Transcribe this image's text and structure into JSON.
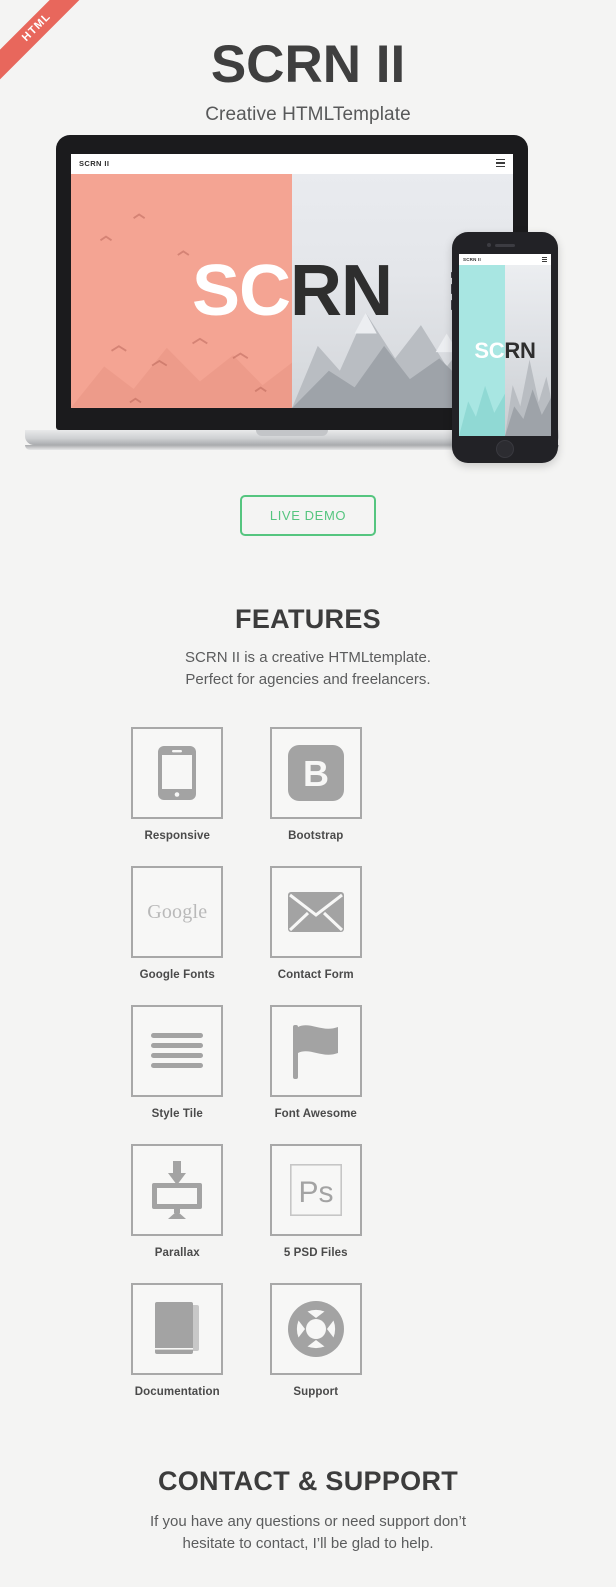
{
  "ribbon": {
    "label": "HTML",
    "color": "#e8675c"
  },
  "hero": {
    "title": "SCRN II",
    "subtitle": "Creative HTMLTemplate"
  },
  "mockup": {
    "laptop": {
      "site_logo": "SCRN II",
      "menu_icon": "hamburger-icon",
      "headline_left": "SC",
      "headline_right": "RN",
      "left_panel_color": "#f4a493",
      "right_panel_color": "#e4e6ea"
    },
    "phone": {
      "site_logo": "SCRN II",
      "menu_icon": "hamburger-icon",
      "headline_left": "SC",
      "headline_right": "RN",
      "left_panel_color": "#a8e6e2",
      "right_panel_color": "#dcdfe3"
    }
  },
  "demo": {
    "label": "LIVE DEMO",
    "color": "#55c57f"
  },
  "features": {
    "title": "FEATURES",
    "description_line1": "SCRN II is a creative HTMLtemplate.",
    "description_line2": "Perfect for agencies and freelancers.",
    "items": [
      {
        "label": "Responsive",
        "icon": "smartphone-icon"
      },
      {
        "label": "Bootstrap",
        "icon": "bootstrap-b-icon"
      },
      {
        "label": "Google Fonts",
        "icon": "google-wordmark-icon",
        "text": "Google"
      },
      {
        "label": "Contact Form",
        "icon": "envelope-icon"
      },
      {
        "label": "Style Tile",
        "icon": "lines-icon"
      },
      {
        "label": "Font Awesome",
        "icon": "flag-icon"
      },
      {
        "label": "Parallax",
        "icon": "monitor-download-icon"
      },
      {
        "label": "5 PSD Files",
        "icon": "photoshop-ps-icon",
        "text": "Ps"
      },
      {
        "label": "Documentation",
        "icon": "book-icon"
      },
      {
        "label": "Support",
        "icon": "life-ring-icon"
      }
    ]
  },
  "contact": {
    "title": "CONTACT & SUPPORT",
    "description_line1": "If you have any questions or need support don’t",
    "description_line2": "hesitate to contact, I’ll be glad to help."
  }
}
